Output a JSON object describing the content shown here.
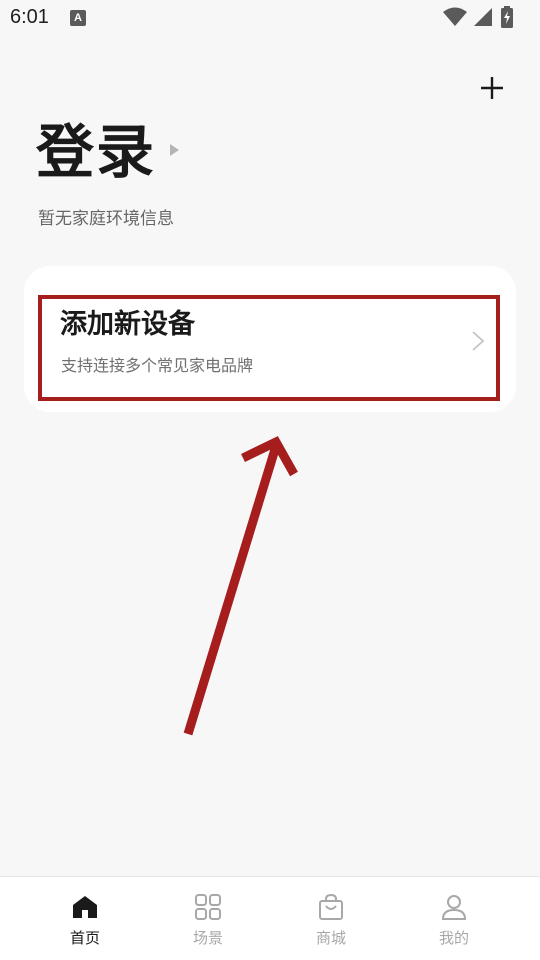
{
  "status_bar": {
    "time": "6:01",
    "notification_icon": "A"
  },
  "header": {
    "add_icon": "plus-icon",
    "title": "登录",
    "subtitle": "暂无家庭环境信息"
  },
  "device_card": {
    "title": "添加新设备",
    "subtitle": "支持连接多个常见家电品牌"
  },
  "colors": {
    "annotation": "#a51d1d",
    "background": "#f7f7f7"
  },
  "bottom_nav": {
    "items": [
      {
        "label": "首页",
        "icon": "home-icon",
        "active": true
      },
      {
        "label": "场景",
        "icon": "grid-icon",
        "active": false
      },
      {
        "label": "商城",
        "icon": "shopping-bag-icon",
        "active": false
      },
      {
        "label": "我的",
        "icon": "person-icon",
        "active": false
      }
    ]
  }
}
